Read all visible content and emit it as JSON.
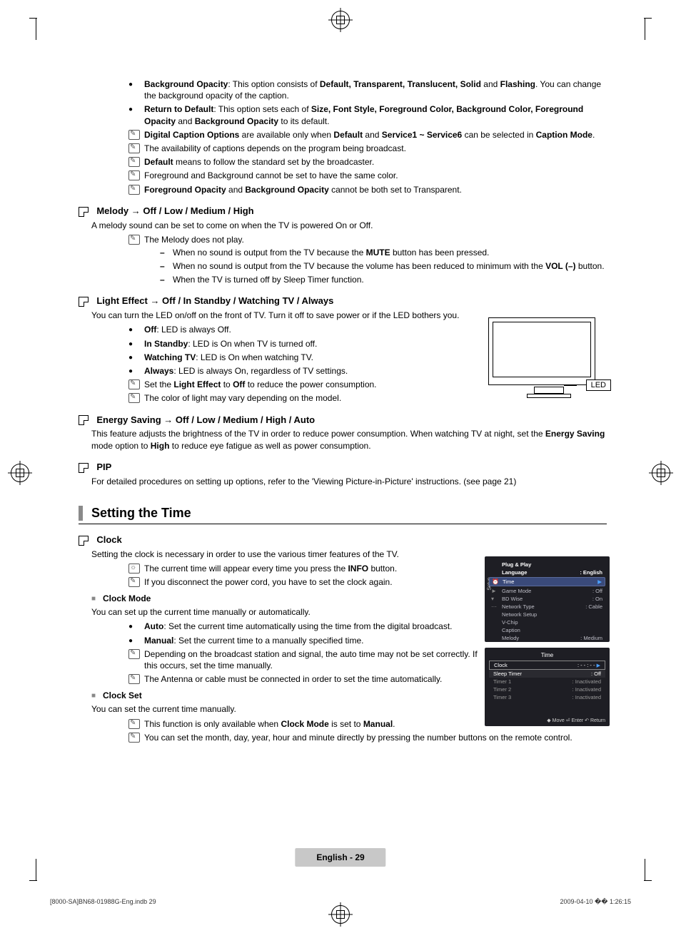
{
  "crop_marks": true,
  "bullets_top": [
    {
      "type": "dot",
      "html": "<b>Background Opacity</b>: This option consists of <b>Default, Transparent, Translucent, Solid</b> and <b>Flashing</b>. You can change the background opacity of the caption."
    },
    {
      "type": "dot",
      "html": "<b>Return to Default</b>: This option sets each of <b>Size, Font Style, Foreground Color, Background Color, Foreground Opacity</b> and <b>Background Opacity</b> to its default."
    },
    {
      "type": "note",
      "html": "<b>Digital Caption Options</b> are available only when <b>Default</b> and <b>Service1 ~ Service6</b> can be selected in <b>Caption Mode</b>."
    },
    {
      "type": "note",
      "html": "The availability of captions depends on the program being broadcast."
    },
    {
      "type": "note",
      "html": "<b>Default</b> means to follow the standard set by the broadcaster."
    },
    {
      "type": "note",
      "html": "Foreground and Background cannot be set to have the same color."
    },
    {
      "type": "note",
      "html": "<b>Foreground Opacity</b> and <b>Background Opacity</b> cannot be both set to Transparent."
    }
  ],
  "melody": {
    "title": "Melody → Off / Low / Medium / High",
    "body": "A melody sound can be set to come on when the TV is powered On or Off.",
    "note": "The Melody does not play.",
    "dashes": [
      "When no sound is output from the TV because the <b>MUTE</b> button has been pressed.",
      "When no sound is output from the TV because the volume has been reduced to minimum with the <b>VOL (–)</b> button.",
      "When the TV is turned off by Sleep Timer function."
    ]
  },
  "light": {
    "title": "Light Effect → Off / In Standby / Watching TV / Always",
    "body": "You can turn the LED on/off on the front of TV. Turn it off to save power or if the LED bothers you.",
    "items": [
      {
        "type": "dot",
        "html": "<b>Off</b>: LED is always Off."
      },
      {
        "type": "dot",
        "html": "<b>In Standby</b>: LED is On when TV is turned off."
      },
      {
        "type": "dot",
        "html": "<b>Watching TV</b>: LED is On when watching TV."
      },
      {
        "type": "dot",
        "html": "<b>Always</b>: LED is always On, regardless of TV settings."
      },
      {
        "type": "note",
        "html": "Set the <b>Light Effect</b> to <b>Off</b> to reduce the power consumption."
      },
      {
        "type": "note",
        "html": "The color of light may vary depending on the model."
      }
    ],
    "callout": "LED"
  },
  "energy": {
    "title": "Energy Saving → Off / Low / Medium / High / Auto",
    "body": "This feature adjusts the brightness of the TV in order to reduce power consumption. When watching TV at night, set the <b>Energy Saving</b> mode option to <b>High</b> to reduce eye fatigue as well as power consumption."
  },
  "pip": {
    "title": "PIP",
    "body": "For detailed procedures on setting up options, refer to the 'Viewing Picture-in-Picture' instructions. (see page 21)"
  },
  "major_heading": "Setting the Time",
  "clock": {
    "title": "Clock",
    "body": "Setting the clock is necessary in order to use the various timer features of the TV.",
    "items": [
      {
        "type": "info",
        "html": "The current time will appear every time you press the <b>INFO</b> button."
      },
      {
        "type": "note",
        "html": "If you disconnect the power cord, you have to set the clock again."
      }
    ],
    "mode": {
      "title": "Clock Mode",
      "body": "You can set up the current time manually or automatically.",
      "items": [
        {
          "type": "dot",
          "html": "<b>Auto</b>: Set the current time automatically using the time from the digital broadcast."
        },
        {
          "type": "dot",
          "html": "<b>Manual</b>: Set the current time to a manually specified time."
        },
        {
          "type": "note",
          "html": "Depending on the broadcast station and signal, the auto time may not be set correctly. If this occurs, set the time manually."
        },
        {
          "type": "note",
          "html": "The Antenna or cable must be connected in order to set the time automatically."
        }
      ]
    },
    "set": {
      "title": "Clock Set",
      "body": "You can set the current time manually.",
      "items": [
        {
          "type": "note",
          "html": "This function is only available when <b>Clock Mode</b> is set to <b>Manual</b>."
        },
        {
          "type": "note",
          "html": "You can set the month, day, year, hour and minute directly by pressing the number buttons on the remote control."
        }
      ]
    }
  },
  "osd1": {
    "side_label": "Setup",
    "rows": [
      {
        "l": "Plug & Play",
        "r": "",
        "bold": true,
        "icon": ""
      },
      {
        "l": "Language",
        "r": "English",
        "bold": true,
        "icon": ""
      },
      {
        "l": "Time",
        "r": "",
        "sel": true,
        "icon": "⏰",
        "arrow": "▶"
      },
      {
        "l": "Game Mode",
        "r": "Off",
        "icon": "►"
      },
      {
        "l": "BD Wise",
        "r": "On",
        "icon": "▾"
      },
      {
        "l": "Network Type",
        "r": "Cable",
        "icon": "⋯"
      },
      {
        "l": "Network Setup",
        "r": ""
      },
      {
        "l": "V-Chip",
        "r": ""
      },
      {
        "l": "Caption",
        "r": ""
      },
      {
        "l": "Melody",
        "r": "Medium"
      }
    ]
  },
  "osd2": {
    "title": "Time",
    "rows": [
      {
        "l": "Clock",
        "r": "- - : - -",
        "sel": true,
        "arrow": "▶"
      },
      {
        "l": "Sleep Timer",
        "r": "Off",
        "hdr": true
      },
      {
        "l": "Timer 1",
        "r": "Inactivated"
      },
      {
        "l": "Timer 2",
        "r": "Inactivated"
      },
      {
        "l": "Timer 3",
        "r": "Inactivated"
      }
    ],
    "footer": "◆ Move    ⏎ Enter    ↶ Return"
  },
  "footer_label": "English - 29",
  "imprint_left": "[8000-SA]BN68-01988G-Eng.indb   29",
  "imprint_right": "2009-04-10   �� 1:26:15"
}
